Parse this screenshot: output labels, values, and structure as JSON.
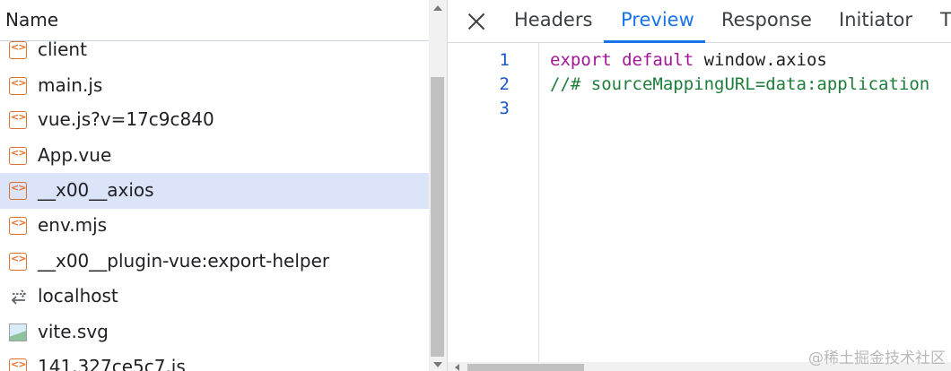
{
  "request_list": {
    "header": "Name",
    "rows": [
      {
        "label": "client",
        "icon": "script-file-icon",
        "selected": false
      },
      {
        "label": "main.js",
        "icon": "script-file-icon",
        "selected": false
      },
      {
        "label": "vue.js?v=17c9c840",
        "icon": "script-file-icon",
        "selected": false
      },
      {
        "label": "App.vue",
        "icon": "script-file-icon",
        "selected": false
      },
      {
        "label": "__x00__axios",
        "icon": "script-file-icon",
        "selected": true
      },
      {
        "label": "env.mjs",
        "icon": "script-file-icon",
        "selected": false
      },
      {
        "label": "__x00__plugin-vue:export-helper",
        "icon": "script-file-icon",
        "selected": false
      },
      {
        "label": "localhost",
        "icon": "websocket-arrows-icon",
        "selected": false
      },
      {
        "label": "vite.svg",
        "icon": "image-file-icon",
        "selected": false
      },
      {
        "label": "141.327ce5c7.js",
        "icon": "script-file-icon",
        "selected": false
      }
    ]
  },
  "detail": {
    "tabs": [
      {
        "label": "Headers",
        "active": false
      },
      {
        "label": "Preview",
        "active": true
      },
      {
        "label": "Response",
        "active": false
      },
      {
        "label": "Initiator",
        "active": false
      },
      {
        "label": "T",
        "active": false
      }
    ],
    "code_lines": [
      {
        "number": "1",
        "keyword": "export default",
        "text": " window.axios"
      },
      {
        "number": "2",
        "comment": "//# sourceMappingURL=data:application"
      },
      {
        "number": "3"
      }
    ]
  },
  "colors": {
    "accent": "#1a73e8",
    "selected_row": "#dbe4f8",
    "keyword": "#a31596",
    "comment": "#1e7d3a",
    "line_number": "#1a56c7",
    "script_icon": "#e0702c"
  },
  "watermark": "@稀土掘金技术社区"
}
